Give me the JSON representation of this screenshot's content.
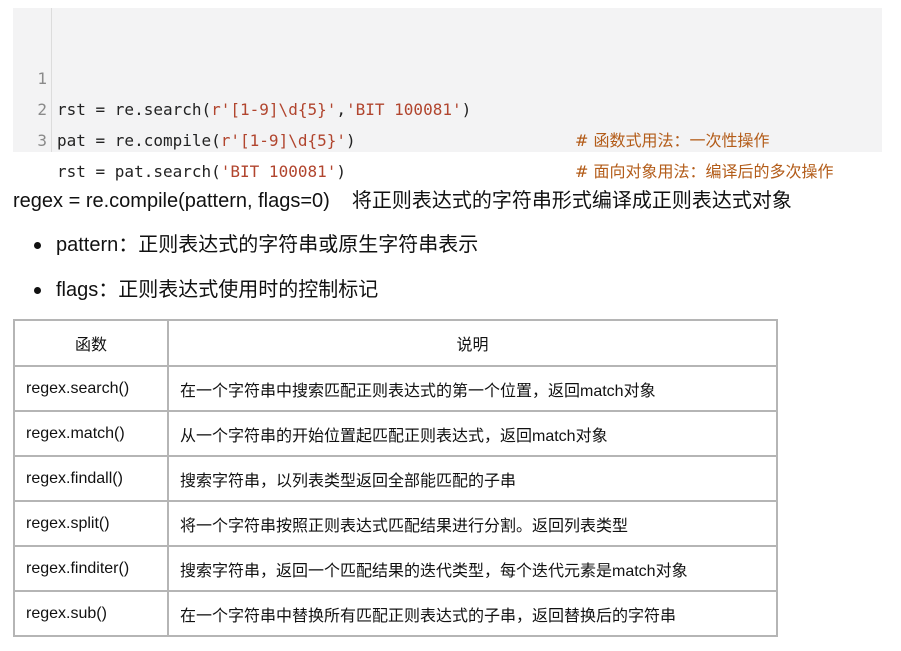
{
  "code": {
    "lines": [
      {
        "num": "1",
        "pre": "rst = re.search(",
        "str1": "r'[1-9]\\d{5}'",
        "mid": ",",
        "str2": "'BIT 100081'",
        "post": ")",
        "comment": "# 函数式用法：一次性操作"
      },
      {
        "num": "2",
        "pre": "pat = re.compile(",
        "str1": "r'[1-9]\\d{5}'",
        "mid": "",
        "str2": "",
        "post": ")",
        "comment": "# 面向对象用法：编译后的多次操作"
      },
      {
        "num": "3",
        "pre": "rst = pat.search(",
        "str1": "'BIT 100081'",
        "mid": "",
        "str2": "",
        "post": ")",
        "comment": ""
      }
    ]
  },
  "description": {
    "signature": "regex = re.compile(pattern, flags=0)",
    "text": "将正则表达式的字符串形式编译成正则表达式对象"
  },
  "bullets": [
    {
      "name": "pattern",
      "sep": "：",
      "text": "正则表达式的字符串或原生字符串表示"
    },
    {
      "name": "flags",
      "sep": "：",
      "text": "正则表达式使用时的控制标记"
    }
  ],
  "table": {
    "headers": [
      "函数",
      "说明"
    ],
    "rows": [
      [
        "regex.search()",
        "在一个字符串中搜索匹配正则表达式的第一个位置，返回match对象"
      ],
      [
        "regex.match()",
        "从一个字符串的开始位置起匹配正则表达式，返回match对象"
      ],
      [
        "regex.findall()",
        "搜索字符串，以列表类型返回全部能匹配的子串"
      ],
      [
        "regex.split()",
        "将一个字符串按照正则表达式匹配结果进行分割。返回列表类型"
      ],
      [
        "regex.finditer()",
        "搜索字符串，返回一个匹配结果的迭代类型，每个迭代元素是match对象"
      ],
      [
        "regex.sub()",
        "在一个字符串中替换所有匹配正则表达式的子串，返回替换后的字符串"
      ]
    ]
  }
}
